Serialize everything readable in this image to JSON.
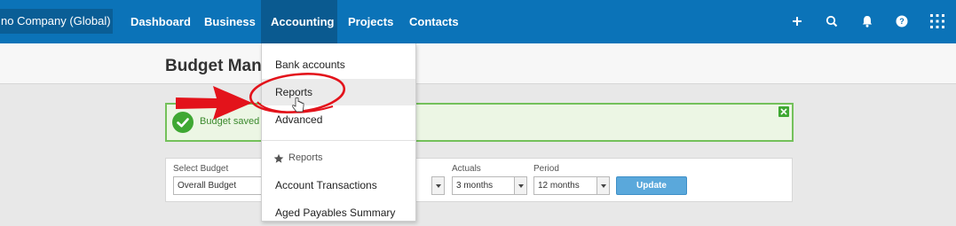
{
  "topnav": {
    "org_label": "no Company (Global)",
    "items": [
      "Dashboard",
      "Business",
      "Accounting",
      "Projects",
      "Contacts"
    ],
    "active": "Accounting",
    "icons": [
      "plus-icon",
      "search-icon",
      "bell-icon",
      "help-icon",
      "app-grid-icon"
    ]
  },
  "page": {
    "title": "Budget Manager"
  },
  "banner": {
    "text": "Budget saved"
  },
  "filters": {
    "select_budget_label": "Select Budget",
    "select_budget_value": "Overall Budget",
    "actuals_label": "Actuals",
    "actuals_value": "3 months",
    "period_label": "Period",
    "period_value": "12 months",
    "update_label": "Update"
  },
  "accounting_menu": {
    "items_top": [
      "Bank accounts",
      "Reports",
      "Advanced"
    ],
    "hovered": "Reports",
    "section_header": "Reports",
    "section_items": [
      "Account Transactions",
      "Aged Payables Summary"
    ]
  },
  "colors": {
    "nav_bg": "#0b73b8",
    "nav_active": "#0a5a90",
    "success_border": "#74c15b",
    "success_icon": "#3fa833",
    "button": "#5aa8db",
    "annotation_red": "#e3131b"
  }
}
